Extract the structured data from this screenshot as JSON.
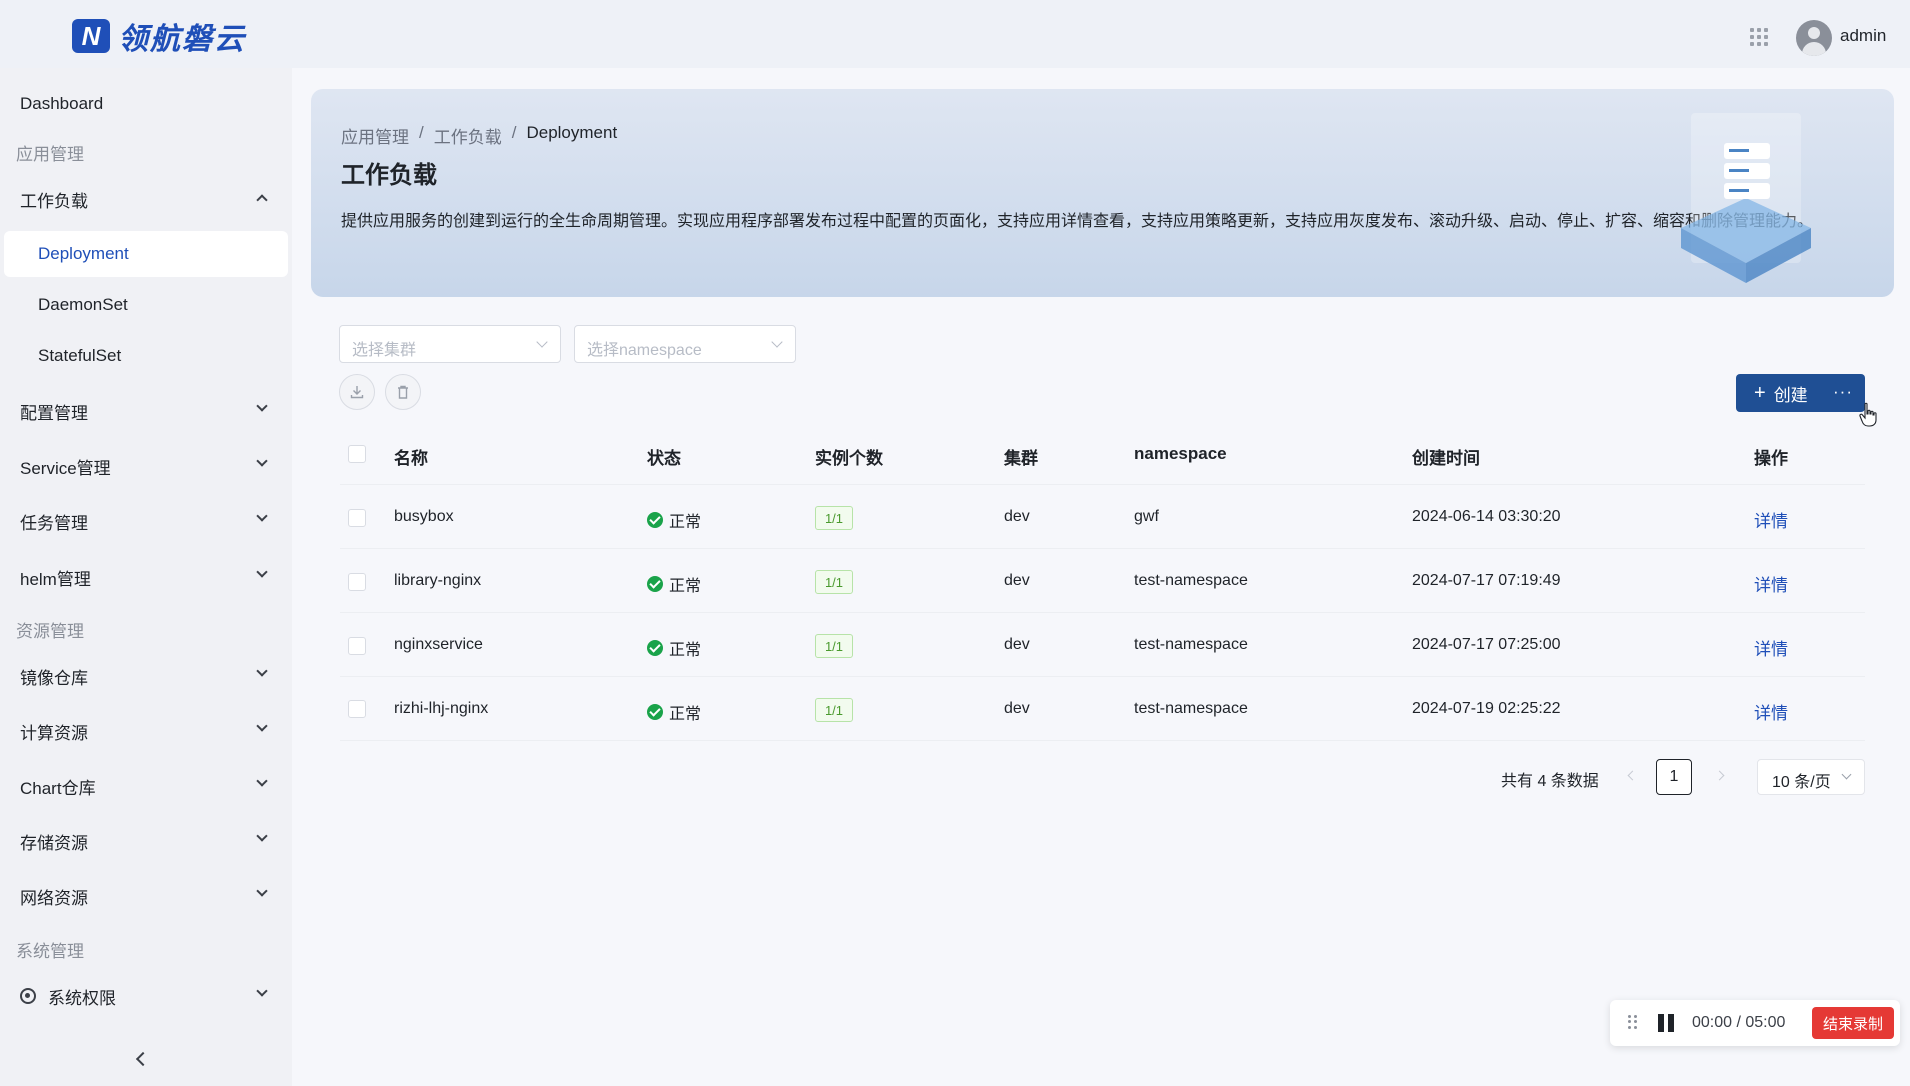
{
  "header": {
    "logo_text": "领航磐云",
    "logo_mark": "N",
    "username": "admin",
    "apps_icon": "grid-icon"
  },
  "sidebar": {
    "dashboard": "Dashboard",
    "group_app": "应用管理",
    "workload": "工作负载",
    "workload_items": [
      "Deployment",
      "DaemonSet",
      "StatefulSet"
    ],
    "config": "配置管理",
    "service": "Service管理",
    "task": "任务管理",
    "helm": "helm管理",
    "group_resource": "资源管理",
    "image_repo": "镜像仓库",
    "compute": "计算资源",
    "chart_repo": "Chart仓库",
    "storage": "存储资源",
    "network": "网络资源",
    "group_system": "系统管理",
    "system_perm": "系统权限"
  },
  "banner": {
    "breadcrumb": [
      "应用管理",
      "工作负载",
      "Deployment"
    ],
    "separator": "/",
    "title": "工作负载",
    "description": "提供应用服务的创建到运行的全生命周期管理。实现应用程序部署发布过程中配置的页面化，支持应用详情查看，支持应用策略更新，支持应用灰度发布、滚动升级、启动、停止、扩容、缩容和删除管理能力。"
  },
  "filters": {
    "cluster_placeholder": "选择集群",
    "namespace_placeholder": "选择namespace"
  },
  "toolbar": {
    "create_label": "创建",
    "more_label": "···"
  },
  "table": {
    "columns": [
      "名称",
      "状态",
      "实例个数",
      "集群",
      "namespace",
      "创建时间",
      "操作"
    ],
    "rows": [
      {
        "name": "busybox",
        "status": "正常",
        "replicas": "1/1",
        "cluster": "dev",
        "namespace": "gwf",
        "created": "2024-06-14 03:30:20",
        "action": "详情"
      },
      {
        "name": "library-nginx",
        "status": "正常",
        "replicas": "1/1",
        "cluster": "dev",
        "namespace": "test-namespace",
        "created": "2024-07-17 07:19:49",
        "action": "详情"
      },
      {
        "name": "nginxservice",
        "status": "正常",
        "replicas": "1/1",
        "cluster": "dev",
        "namespace": "test-namespace",
        "created": "2024-07-17 07:25:00",
        "action": "详情"
      },
      {
        "name": "rizhi-lhj-nginx",
        "status": "正常",
        "replicas": "1/1",
        "cluster": "dev",
        "namespace": "test-namespace",
        "created": "2024-07-19 02:25:22",
        "action": "详情"
      }
    ]
  },
  "pagination": {
    "total_text": "共有 4 条数据",
    "current_page": "1",
    "page_size": "10 条/页"
  },
  "recorder": {
    "timer": "00:00 / 05:00",
    "stop_label": "结束录制"
  },
  "colors": {
    "primary": "#1f4f94",
    "link": "#1f4fb8",
    "success": "#1aa34a",
    "danger": "#e53935"
  }
}
